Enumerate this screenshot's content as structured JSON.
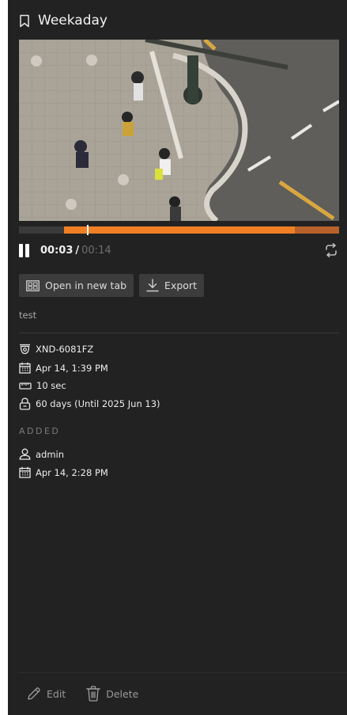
{
  "header": {
    "title": "Weekaday",
    "icon": "bookmark-icon"
  },
  "player": {
    "current_time": "00:03",
    "separator": "/",
    "duration": "00:14",
    "progress_fraction": 0.214,
    "buffered_fraction": 0.862,
    "accent_color": "#f07f24"
  },
  "actions": {
    "open_in_new_tab_label": "Open in new tab",
    "export_label": "Export"
  },
  "description": "test",
  "info": {
    "camera": "XND-6081FZ",
    "recorded_at": "Apr 14, 1:39 PM",
    "length": "10 sec",
    "retention": "60 days (Until 2025 Jun 13)"
  },
  "added": {
    "section_label": "ADDED",
    "user": "admin",
    "added_at": "Apr 14, 2:28 PM"
  },
  "footer": {
    "edit_label": "Edit",
    "delete_label": "Delete"
  }
}
